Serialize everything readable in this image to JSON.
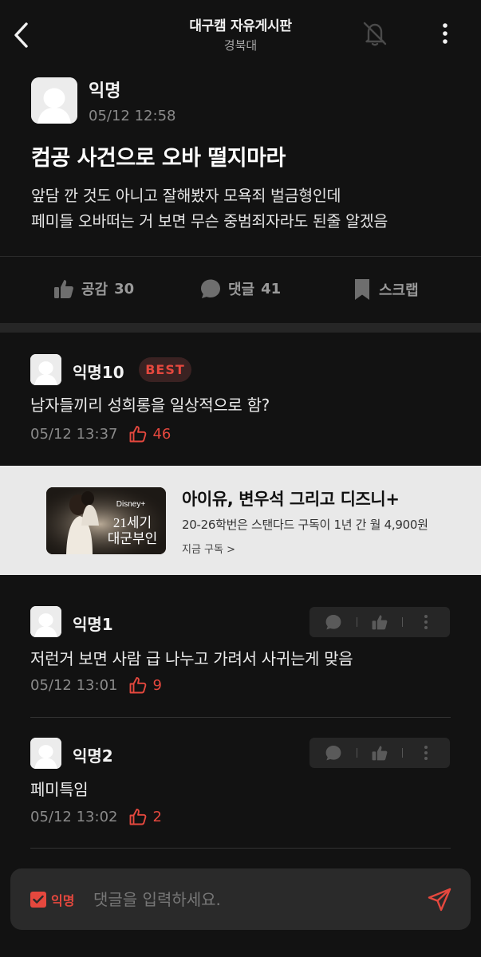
{
  "header": {
    "title": "대구캠 자유게시판",
    "subtitle": "경북대",
    "icons": {
      "back": "chevron-left-icon",
      "notify": "bell-off-icon",
      "more": "more-vertical-icon"
    }
  },
  "post": {
    "author": "익명",
    "time": "05/12 12:58",
    "title": "컴공 사건으로 오바 떨지마라",
    "body_lines": [
      "앞담 깐 것도 아니고 잘해봤자 모욕죄 벌금형인데",
      "페미들 오바떠는 거 보면 무슨 중범죄자라도 된줄 알겠음"
    ],
    "actions": [
      {
        "label": "공감",
        "count": "30",
        "icon": "thumbs-up-icon"
      },
      {
        "label": "댓글",
        "count": "41",
        "icon": "chat-bubble-icon"
      },
      {
        "label": "스크랩",
        "count": "",
        "icon": "bookmark-icon"
      }
    ]
  },
  "comments": [
    {
      "author": "익명10",
      "badge": "BEST",
      "text": "남자들끼리 성희롱을 일상적으로 함?",
      "time": "05/12 13:37",
      "likes": "46"
    },
    {
      "author": "익명1",
      "text": "저런거 보면 사람 급 나누고 가려서 사귀는게 맞음",
      "time": "05/12 13:01",
      "likes": "9"
    },
    {
      "author": "익명2",
      "text": "페미특임",
      "time": "05/12 13:02",
      "likes": "2"
    }
  ],
  "ad": {
    "title": "아이유, 변우석 그리고 디즈니+",
    "desc": "20-26학번은 스탠다드 구독이 1년 간 월 4,900원",
    "cta": "지금 구독 >",
    "thumb_brand": "Disney+",
    "thumb_text_1": "21세기",
    "thumb_text_2": "대군부인"
  },
  "input": {
    "anon_label": "익명",
    "anon_checked": true,
    "placeholder": "댓글을 입력하세요.",
    "value": ""
  },
  "colors": {
    "background": "#121212",
    "accent": "#e5483e",
    "ad_bg": "#e9e9e9"
  }
}
